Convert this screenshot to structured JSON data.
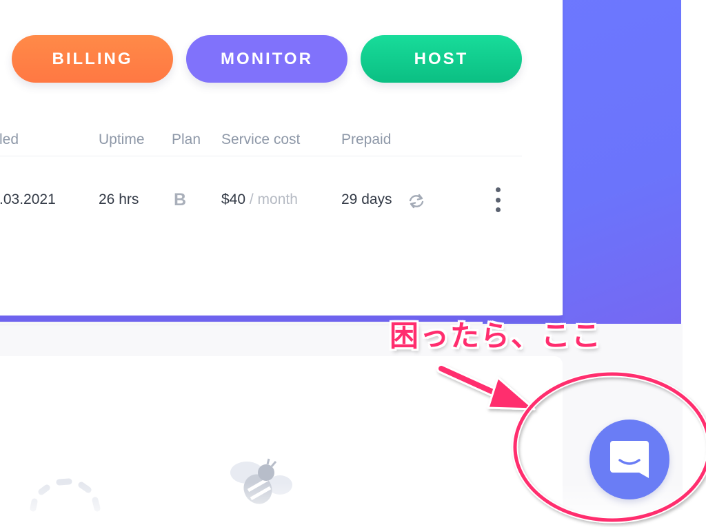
{
  "actions": {
    "billing_label": "BILLING",
    "monitor_label": "MONITOR",
    "host_label": "HOST"
  },
  "table": {
    "columns": [
      "led",
      "Uptime",
      "Plan",
      "Service cost",
      "Prepaid"
    ],
    "row": {
      "date": ".03.2021",
      "uptime": "26 hrs",
      "plan": "B",
      "cost_amount": "$40",
      "cost_period": " / month",
      "prepaid": "29 days"
    }
  },
  "annotation": {
    "text": "困ったら、ここ",
    "color": "#ff2d6e"
  },
  "icons": {
    "refresh": "refresh-icon",
    "more": "more-vertical-icon",
    "chat": "chat-icon"
  },
  "colors": {
    "billing": "#ff7f45",
    "monitor": "#8072fb",
    "host": "#10cf8d",
    "panel": "#6d78ff",
    "chat": "#6a7df5"
  }
}
